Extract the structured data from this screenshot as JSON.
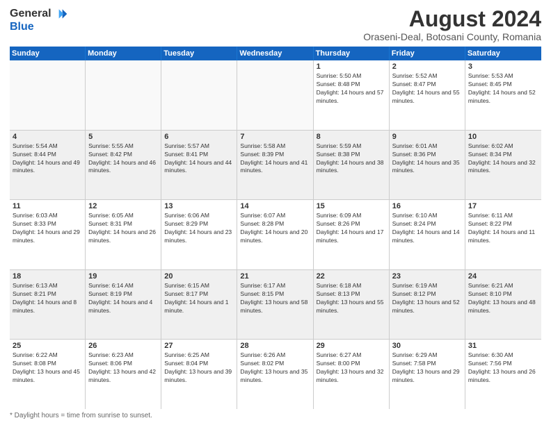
{
  "header": {
    "logo_general": "General",
    "logo_blue": "Blue",
    "title": "August 2024",
    "subtitle": "Oraseni-Deal, Botosani County, Romania"
  },
  "days_of_week": [
    "Sunday",
    "Monday",
    "Tuesday",
    "Wednesday",
    "Thursday",
    "Friday",
    "Saturday"
  ],
  "weeks": [
    [
      {
        "day": "",
        "empty": true
      },
      {
        "day": "",
        "empty": true
      },
      {
        "day": "",
        "empty": true
      },
      {
        "day": "",
        "empty": true
      },
      {
        "day": "1",
        "sunrise": "5:50 AM",
        "sunset": "8:48 PM",
        "daylight": "14 hours and 57 minutes."
      },
      {
        "day": "2",
        "sunrise": "5:52 AM",
        "sunset": "8:47 PM",
        "daylight": "14 hours and 55 minutes."
      },
      {
        "day": "3",
        "sunrise": "5:53 AM",
        "sunset": "8:45 PM",
        "daylight": "14 hours and 52 minutes."
      }
    ],
    [
      {
        "day": "4",
        "sunrise": "5:54 AM",
        "sunset": "8:44 PM",
        "daylight": "14 hours and 49 minutes."
      },
      {
        "day": "5",
        "sunrise": "5:55 AM",
        "sunset": "8:42 PM",
        "daylight": "14 hours and 46 minutes."
      },
      {
        "day": "6",
        "sunrise": "5:57 AM",
        "sunset": "8:41 PM",
        "daylight": "14 hours and 44 minutes."
      },
      {
        "day": "7",
        "sunrise": "5:58 AM",
        "sunset": "8:39 PM",
        "daylight": "14 hours and 41 minutes."
      },
      {
        "day": "8",
        "sunrise": "5:59 AM",
        "sunset": "8:38 PM",
        "daylight": "14 hours and 38 minutes."
      },
      {
        "day": "9",
        "sunrise": "6:01 AM",
        "sunset": "8:36 PM",
        "daylight": "14 hours and 35 minutes."
      },
      {
        "day": "10",
        "sunrise": "6:02 AM",
        "sunset": "8:34 PM",
        "daylight": "14 hours and 32 minutes."
      }
    ],
    [
      {
        "day": "11",
        "sunrise": "6:03 AM",
        "sunset": "8:33 PM",
        "daylight": "14 hours and 29 minutes."
      },
      {
        "day": "12",
        "sunrise": "6:05 AM",
        "sunset": "8:31 PM",
        "daylight": "14 hours and 26 minutes."
      },
      {
        "day": "13",
        "sunrise": "6:06 AM",
        "sunset": "8:29 PM",
        "daylight": "14 hours and 23 minutes."
      },
      {
        "day": "14",
        "sunrise": "6:07 AM",
        "sunset": "8:28 PM",
        "daylight": "14 hours and 20 minutes."
      },
      {
        "day": "15",
        "sunrise": "6:09 AM",
        "sunset": "8:26 PM",
        "daylight": "14 hours and 17 minutes."
      },
      {
        "day": "16",
        "sunrise": "6:10 AM",
        "sunset": "8:24 PM",
        "daylight": "14 hours and 14 minutes."
      },
      {
        "day": "17",
        "sunrise": "6:11 AM",
        "sunset": "8:22 PM",
        "daylight": "14 hours and 11 minutes."
      }
    ],
    [
      {
        "day": "18",
        "sunrise": "6:13 AM",
        "sunset": "8:21 PM",
        "daylight": "14 hours and 8 minutes."
      },
      {
        "day": "19",
        "sunrise": "6:14 AM",
        "sunset": "8:19 PM",
        "daylight": "14 hours and 4 minutes."
      },
      {
        "day": "20",
        "sunrise": "6:15 AM",
        "sunset": "8:17 PM",
        "daylight": "14 hours and 1 minute."
      },
      {
        "day": "21",
        "sunrise": "6:17 AM",
        "sunset": "8:15 PM",
        "daylight": "13 hours and 58 minutes."
      },
      {
        "day": "22",
        "sunrise": "6:18 AM",
        "sunset": "8:13 PM",
        "daylight": "13 hours and 55 minutes."
      },
      {
        "day": "23",
        "sunrise": "6:19 AM",
        "sunset": "8:12 PM",
        "daylight": "13 hours and 52 minutes."
      },
      {
        "day": "24",
        "sunrise": "6:21 AM",
        "sunset": "8:10 PM",
        "daylight": "13 hours and 48 minutes."
      }
    ],
    [
      {
        "day": "25",
        "sunrise": "6:22 AM",
        "sunset": "8:08 PM",
        "daylight": "13 hours and 45 minutes."
      },
      {
        "day": "26",
        "sunrise": "6:23 AM",
        "sunset": "8:06 PM",
        "daylight": "13 hours and 42 minutes."
      },
      {
        "day": "27",
        "sunrise": "6:25 AM",
        "sunset": "8:04 PM",
        "daylight": "13 hours and 39 minutes."
      },
      {
        "day": "28",
        "sunrise": "6:26 AM",
        "sunset": "8:02 PM",
        "daylight": "13 hours and 35 minutes."
      },
      {
        "day": "29",
        "sunrise": "6:27 AM",
        "sunset": "8:00 PM",
        "daylight": "13 hours and 32 minutes."
      },
      {
        "day": "30",
        "sunrise": "6:29 AM",
        "sunset": "7:58 PM",
        "daylight": "13 hours and 29 minutes."
      },
      {
        "day": "31",
        "sunrise": "6:30 AM",
        "sunset": "7:56 PM",
        "daylight": "13 hours and 26 minutes."
      }
    ]
  ],
  "footer": {
    "note": "Daylight hours"
  }
}
